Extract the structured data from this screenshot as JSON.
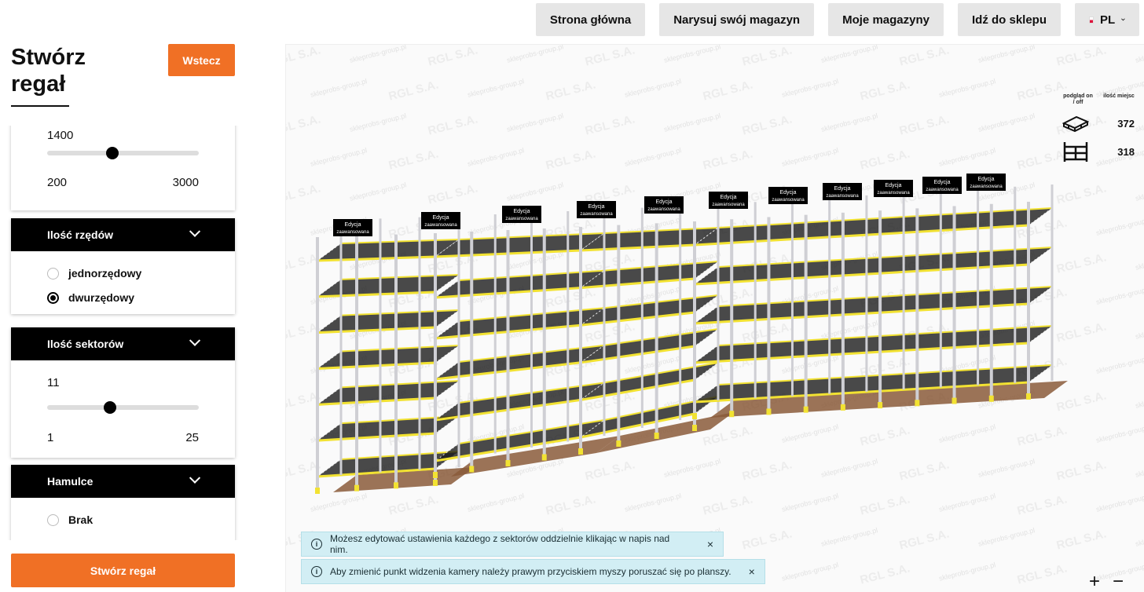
{
  "nav": {
    "home": "Strona główna",
    "draw": "Narysuj swój magazyn",
    "my": "Moje magazyny",
    "shop": "Idź do sklepu",
    "lang": "PL"
  },
  "sidebar": {
    "title_line1": "Stwórz",
    "title_line2": "regał",
    "back_label": "Wstecz",
    "slider_top": {
      "value": "1400",
      "min": "200",
      "max": "3000",
      "fraction": 0.429
    },
    "rows": {
      "header": "Ilość rzędów",
      "options": [
        "jednorzędowy",
        "dwurzędowy"
      ],
      "selected": 1
    },
    "sectors": {
      "header": "Ilość sektorów",
      "value": "11",
      "min": "1",
      "max": "25",
      "fraction": 0.417
    },
    "brakes": {
      "header": "Hamulce",
      "options": [
        "Brak"
      ]
    },
    "create_label": "Stwórz regał"
  },
  "viewport": {
    "watermark_main": "RGL S.A.",
    "watermark_sub": "skleprobs-group.pl",
    "edit_label_line1": "Edycja",
    "edit_label_line2": "zaawansowana",
    "stats": {
      "col1": "podgląd on / off",
      "col2": "ilość miejsc",
      "pallet_count": "372",
      "rack_count": "318"
    },
    "toast1": "Możesz edytować ustawienia każdego z sektorów oddzielnie klikając w napis nad nim.",
    "toast2": "Aby zmienić punkt widzenia kamery należy prawym przyciskiem myszy poruszać się po planszy.",
    "zoom_in": "+",
    "zoom_out": "−",
    "info_glyph": "i",
    "close_glyph": "×"
  },
  "colors": {
    "accent": "#f07025",
    "beam": "#f2e232",
    "upright": "#cfcfd4",
    "deck": "#1d1d1d",
    "pallet": "#8a5a3a"
  }
}
